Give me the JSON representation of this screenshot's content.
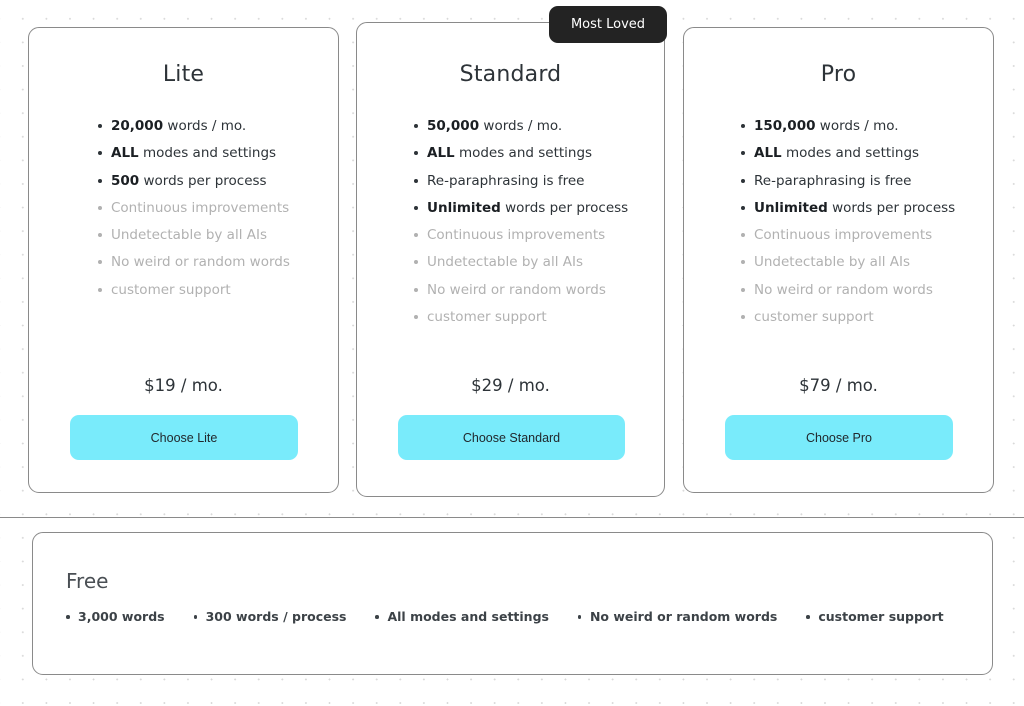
{
  "theme": {
    "accent": "#79ebfb",
    "badge_bg": "#232323",
    "card_border": "#8a8a8a",
    "text_active": "#2d3338",
    "text_muted": "#b1b1b1"
  },
  "badge": {
    "label": "Most Loved"
  },
  "plans": [
    {
      "id": "lite",
      "title": "Lite",
      "price": "$19 / mo.",
      "cta": "Choose Lite",
      "features": [
        {
          "strong": "20,000",
          "rest": " words / mo.",
          "active": true
        },
        {
          "strong": "ALL",
          "rest": " modes and settings",
          "active": true
        },
        {
          "strong": "500",
          "rest": " words per process",
          "active": true
        },
        {
          "strong": "",
          "rest": "Continuous improvements",
          "active": false
        },
        {
          "strong": "",
          "rest": "Undetectable by all AIs",
          "active": false
        },
        {
          "strong": "",
          "rest": "No weird or random words",
          "active": false
        },
        {
          "strong": "",
          "rest": "customer support",
          "active": false
        }
      ]
    },
    {
      "id": "standard",
      "title": "Standard",
      "price": "$29 / mo.",
      "cta": "Choose Standard",
      "features": [
        {
          "strong": "50,000",
          "rest": " words / mo.",
          "active": true
        },
        {
          "strong": "ALL",
          "rest": " modes and settings",
          "active": true
        },
        {
          "strong": "",
          "rest": "Re-paraphrasing is free",
          "active": true
        },
        {
          "strong": "Unlimited",
          "rest": " words per process",
          "active": true
        },
        {
          "strong": "",
          "rest": "Continuous improvements",
          "active": false
        },
        {
          "strong": "",
          "rest": "Undetectable by all AIs",
          "active": false
        },
        {
          "strong": "",
          "rest": "No weird or random words",
          "active": false
        },
        {
          "strong": "",
          "rest": "customer support",
          "active": false
        }
      ]
    },
    {
      "id": "pro",
      "title": "Pro",
      "price": "$79 / mo.",
      "cta": "Choose Pro",
      "features": [
        {
          "strong": "150,000",
          "rest": " words / mo.",
          "active": true
        },
        {
          "strong": "ALL",
          "rest": " modes and settings",
          "active": true
        },
        {
          "strong": "",
          "rest": "Re-paraphrasing is free",
          "active": true
        },
        {
          "strong": "Unlimited",
          "rest": " words per process",
          "active": true
        },
        {
          "strong": "",
          "rest": "Continuous improvements",
          "active": false
        },
        {
          "strong": "",
          "rest": "Undetectable by all AIs",
          "active": false
        },
        {
          "strong": "",
          "rest": "No weird or random words",
          "active": false
        },
        {
          "strong": "",
          "rest": "customer support",
          "active": false
        }
      ]
    }
  ],
  "free_plan": {
    "title": "Free",
    "features": [
      "3,000 words",
      "300 words / process",
      "All modes and settings",
      "No weird or random words",
      "customer support"
    ]
  }
}
